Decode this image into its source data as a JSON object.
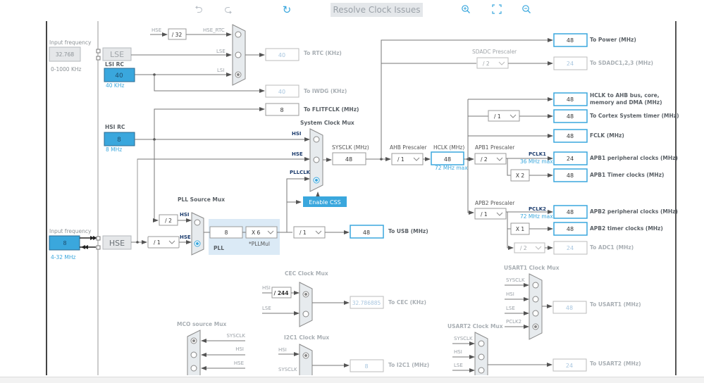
{
  "toolbar": {
    "undo_icon": "undo-icon",
    "redo_icon": "redo-icon",
    "refresh_icon": "refresh-icon",
    "resolve_label": "Resolve Clock Issues",
    "zoom_in_icon": "zoom-in-icon",
    "fit_icon": "fit-to-screen-icon",
    "zoom_out_icon": "zoom-out-icon"
  },
  "colors": {
    "accent": "#3aa7dd",
    "active_source": "#3aa7dd",
    "pll_bg": "#dbeaf6",
    "mux_fill": "#e7ebee"
  },
  "lse_input": {
    "label": "Input frequency",
    "value": "32.768",
    "range": "0-1000 KHz",
    "block": "LSE"
  },
  "lsi": {
    "title": "LSI RC",
    "value": "40",
    "freq": "40 KHz"
  },
  "hsi": {
    "title": "HSI RC",
    "value": "8",
    "freq": "8 MHz"
  },
  "hse_input": {
    "label": "Input frequency",
    "value": "8",
    "range": "4-32 MHz",
    "block": "HSE"
  },
  "rtc_mux": {
    "div": "/ 32",
    "inputs": [
      "HSE",
      "HSE_RTC",
      "LSE",
      "LSI"
    ],
    "selected": "LSI"
  },
  "outputs_left": {
    "rtc": {
      "value": "40",
      "label": "To RTC (KHz)"
    },
    "iwdg": {
      "value": "40",
      "label": "To IWDG (KHz)"
    },
    "flitf": {
      "value": "8",
      "label": "To FLITFCLK (MHz)"
    }
  },
  "sysclk_mux": {
    "title": "System Clock Mux",
    "inputs": [
      "HSI",
      "HSE",
      "PLLCLK"
    ],
    "selected": "PLLCLK",
    "css_button": "Enable CSS"
  },
  "sysclk": {
    "label": "SYSCLK (MHz)",
    "value": "48"
  },
  "ahb": {
    "label": "AHB Prescaler",
    "value": "/ 1"
  },
  "hclk": {
    "label": "HCLK (MHz)",
    "value": "48",
    "max": "72 MHz max"
  },
  "pll_src_mux": {
    "title": "PLL Source Mux",
    "hsi_div": "/ 2",
    "hse_div": "/ 1",
    "inputs": [
      "HSI",
      "HSE"
    ],
    "selected": "HSE"
  },
  "pll": {
    "label": "PLL",
    "value": "8",
    "mul": "X 6",
    "mul_label": "*PLLMul"
  },
  "usb": {
    "div": "/ 1",
    "value": "48",
    "label": "To USB (MHz)"
  },
  "right_outputs": [
    {
      "id": "power",
      "value": "48",
      "label": "To Power (MHz)",
      "active": true
    },
    {
      "id": "sdadc",
      "prescaler_label": "SDADC Prescaler",
      "prescaler": "/ 2",
      "value": "24",
      "label": "To SDADC1,2,3 (MHz)",
      "active": false
    },
    {
      "id": "hclk-ahb",
      "value": "48",
      "label": "HCLK to AHB bus, core,",
      "label2": "memory and DMA (MHz)",
      "active": true
    },
    {
      "id": "cortex",
      "prescaler": "/ 1",
      "value": "48",
      "label": "To Cortex System timer (MHz)",
      "active": true
    },
    {
      "id": "fclk",
      "value": "48",
      "label": "FCLK (MHz)",
      "active": true
    },
    {
      "id": "apb1-periph",
      "value": "24",
      "label": "APB1 peripheral clocks (MHz)",
      "active": true
    },
    {
      "id": "apb1-timer",
      "mult": "X 2",
      "value": "48",
      "label": "APB1 Timer clocks (MHz)",
      "active": true
    },
    {
      "id": "apb2-periph",
      "value": "48",
      "label": "APB2 peripheral clocks (MHz)",
      "active": true
    },
    {
      "id": "apb2-timer",
      "mult": "X 1",
      "value": "48",
      "label": "APB2 timer clocks (MHz)",
      "active": true
    },
    {
      "id": "adc1",
      "prescaler": "/ 2",
      "value": "24",
      "label": "To ADC1 (MHz)",
      "active": false
    }
  ],
  "apb1": {
    "label": "APB1 Prescaler",
    "value": "/ 2",
    "pclk": "PCLK1",
    "max": "36 MHz max"
  },
  "apb2": {
    "label": "APB2 Prescaler",
    "value": "/ 1",
    "pclk": "PCLK2",
    "max": "72 MHz max"
  },
  "cec_mux": {
    "title": "CEC Clock Mux",
    "div": "/ 244",
    "inputs": [
      "HSI",
      "LSE"
    ],
    "selected": "HSI",
    "value": "32.786885",
    "label": "To CEC (KHz)"
  },
  "mco_mux": {
    "title": "MCO source Mux",
    "inputs": [
      "SYSCLK",
      "HSI",
      "HSE"
    ],
    "selected": "SYSCLK"
  },
  "i2c1_mux": {
    "title": "I2C1 Clock Mux",
    "inputs": [
      "HSI",
      "SYSCLK"
    ],
    "selected": "HSI",
    "value": "8",
    "label": "To I2C1 (MHz)"
  },
  "usart1_mux": {
    "title": "USART1 Clock Mux",
    "inputs": [
      "SYSCLK",
      "HSI",
      "LSE",
      "PCLK2"
    ],
    "selected": "PCLK2",
    "value": "48",
    "label": "To USART1 (MHz)"
  },
  "usart2_mux": {
    "title": "USART2 Clock Mux",
    "inputs": [
      "SYSCLK",
      "HSI",
      "LSE"
    ],
    "value": "24",
    "label": "To USART2 (MHz)"
  }
}
